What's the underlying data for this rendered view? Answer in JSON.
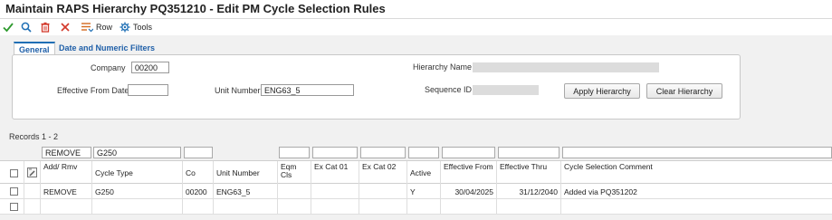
{
  "window": {
    "title": "Maintain RAPS Hierarchy PQ351210 - Edit PM Cycle Selection Rules"
  },
  "toolbar": {
    "row_label": "Row",
    "tools_label": "Tools",
    "colors": {
      "ok": "#2e9a2e",
      "search": "#1f6fb5",
      "delete": "#d33a2c",
      "cancel": "#d33a2c"
    }
  },
  "tabs": [
    {
      "label": "General",
      "active": true
    },
    {
      "label": "Date and Numeric Filters",
      "active": false
    }
  ],
  "form": {
    "company_label": "Company",
    "company_value": "00200",
    "effective_from_label": "Effective From Date",
    "effective_from_value": "",
    "unit_number_label": "Unit Number",
    "unit_number_value": "ENG63_5",
    "hierarchy_name_label": "Hierarchy Name",
    "sequence_id_label": "Sequence ID",
    "apply_button": "Apply Hierarchy",
    "clear_button": "Clear Hierarchy"
  },
  "grid": {
    "records_label": "Records 1 - 2",
    "qbe": {
      "add_rmv": "REMOVE",
      "cycle_type": "G250"
    },
    "columns": {
      "add_rmv": "Add/ Rmv",
      "cycle_type": "Cycle Type",
      "co": "Co",
      "unit_number": "Unit Number",
      "eqm_cls": "Eqm Cls",
      "ex_cat_01": "Ex Cat 01",
      "ex_cat_02": "Ex Cat 02",
      "active": "Active",
      "effective_from": "Effective From",
      "effective_thru": "Effective Thru",
      "comment": "Cycle Selection Comment"
    },
    "rows": [
      {
        "add_rmv": "REMOVE",
        "cycle_type": "G250",
        "co": "00200",
        "unit_number": "ENG63_5",
        "eqm_cls": "",
        "ex_cat_01": "",
        "ex_cat_02": "",
        "active": "Y",
        "effective_from": "30/04/2025",
        "effective_thru": "31/12/2040",
        "comment": "Added via PQ351202"
      },
      {
        "add_rmv": "",
        "cycle_type": "",
        "co": "",
        "unit_number": "",
        "eqm_cls": "",
        "ex_cat_01": "",
        "ex_cat_02": "",
        "active": "",
        "effective_from": "",
        "effective_thru": "",
        "comment": ""
      }
    ]
  }
}
